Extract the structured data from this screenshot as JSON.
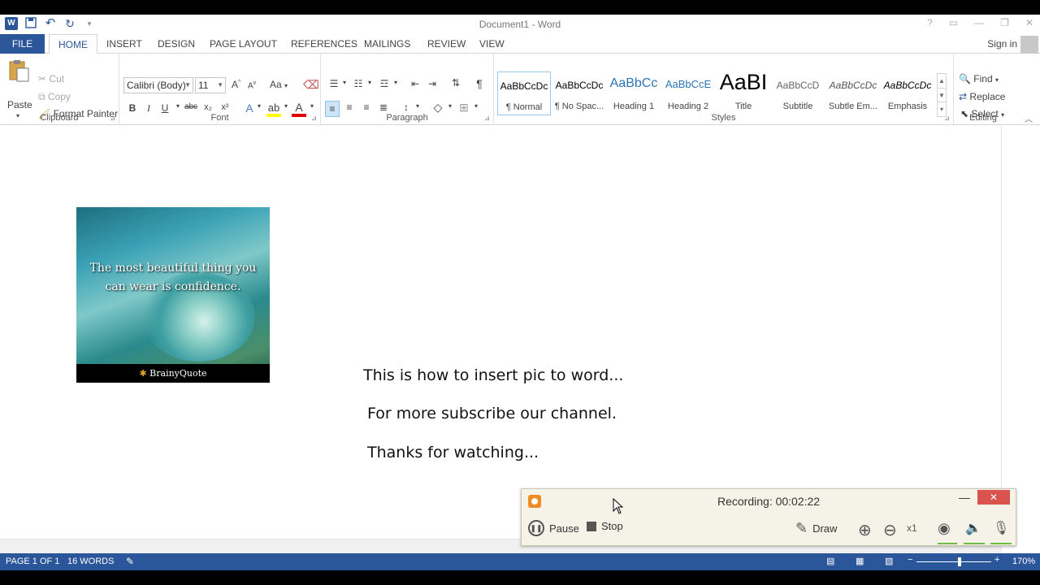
{
  "window": {
    "title": "Document1 - Word",
    "help": "?",
    "controls": [
      "ribbon-display",
      "minimize",
      "restore",
      "close"
    ]
  },
  "qat": {
    "logo": "W",
    "undo": "↶",
    "redo": "↻",
    "customize": "▾"
  },
  "tabs": {
    "file": "FILE",
    "items": [
      "HOME",
      "INSERT",
      "DESIGN",
      "PAGE LAYOUT",
      "REFERENCES",
      "MAILINGS",
      "REVIEW",
      "VIEW"
    ],
    "active": "HOME",
    "signin": "Sign in"
  },
  "ribbon": {
    "clipboard": {
      "label": "Clipboard",
      "paste": "Paste",
      "cut": "Cut",
      "copy": "Copy",
      "format_painter": "Format Painter"
    },
    "font": {
      "label": "Font",
      "font_name": "Calibri (Body)",
      "font_size": "11",
      "case": "Aa"
    },
    "paragraph": {
      "label": "Paragraph"
    },
    "styles": {
      "label": "Styles",
      "items": [
        {
          "preview": "AaBbCcDc",
          "name": "¶ Normal"
        },
        {
          "preview": "AaBbCcDc",
          "name": "¶ No Spac..."
        },
        {
          "preview": "AaBbCc",
          "name": "Heading 1"
        },
        {
          "preview": "AaBbCcE",
          "name": "Heading 2"
        },
        {
          "preview": "AaBI",
          "name": "Title"
        },
        {
          "preview": "AaBbCcD",
          "name": "Subtitle"
        },
        {
          "preview": "AaBbCcDc",
          "name": "Subtle Em..."
        },
        {
          "preview": "AaBbCcDc",
          "name": "Emphasis"
        }
      ]
    },
    "editing": {
      "label": "Editing",
      "find": "Find",
      "replace": "Replace",
      "select": "Select"
    }
  },
  "document": {
    "image": {
      "quote": "The most beautiful thing you can wear is confidence.",
      "brand": "BrainyQuote"
    },
    "lines": [
      "This is how to insert pic to word...",
      "For more subscribe our channel.",
      "Thanks for watching..."
    ]
  },
  "recorder": {
    "status": "Recording:  00:02:22",
    "pause": "Pause",
    "stop": "Stop",
    "draw": "Draw",
    "zoom_level": "x1",
    "close": "✕",
    "minimize": "—"
  },
  "statusbar": {
    "page": "PAGE 1 OF 1",
    "words": "16 WORDS",
    "zoom": "170%"
  },
  "colors": {
    "accent": "#2b579a",
    "recorder_bg": "#f5f3e8",
    "close_red": "#d9534f"
  }
}
